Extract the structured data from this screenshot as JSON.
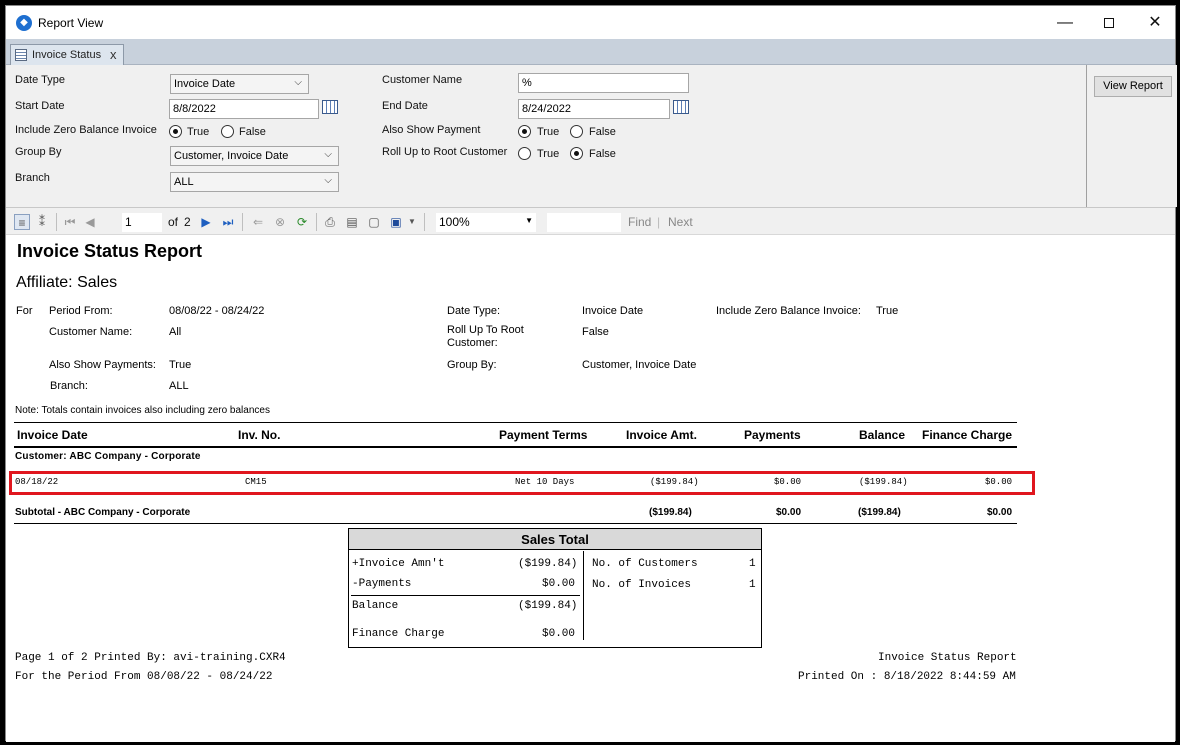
{
  "window": {
    "title": "Report View",
    "minimize": "—",
    "close": "✕"
  },
  "tab": {
    "label": "Invoice Status",
    "close": "x"
  },
  "params": {
    "date_type_label": "Date Type",
    "date_type_value": "Invoice Date",
    "start_date_label": "Start Date",
    "start_date_value": "8/8/2022",
    "include_zero_label": "Include Zero Balance Invoice",
    "true_label": "True",
    "false_label": "False",
    "group_by_label": "Group By",
    "group_by_value": "Customer, Invoice Date",
    "branch_label": "Branch",
    "branch_value": "ALL",
    "customer_name_label": "Customer Name",
    "customer_name_value": "%",
    "end_date_label": "End Date",
    "end_date_value": "8/24/2022",
    "also_show_payment_label": "Also Show Payment",
    "roll_up_label": "Roll Up to Root Customer",
    "view_report": "View Report"
  },
  "toolbar": {
    "page_current": "1",
    "page_of": "of",
    "page_total": "2",
    "zoom": "100%",
    "find": "Find",
    "separator": "|",
    "next": "Next"
  },
  "report": {
    "title": "Invoice Status Report",
    "affiliate": "Affiliate: Sales",
    "for_label": "For",
    "period_from_label": "Period From:",
    "period_from_value": "08/08/22 - 08/24/22",
    "customer_name_label": "Customer Name:",
    "customer_name_value": "All",
    "also_show_payments_label": "Also Show Payments:",
    "also_show_payments_value": "True",
    "branch_label": "Branch:",
    "branch_value": "ALL",
    "date_type_label": "Date Type:",
    "date_type_value": "Invoice Date",
    "roll_up_label_1": "Roll Up To Root",
    "roll_up_label_2": "Customer:",
    "roll_up_value": "False",
    "group_by_label": "Group By:",
    "group_by_value": "Customer, Invoice Date",
    "include_zero_label": "Include Zero Balance Invoice:",
    "include_zero_value": "True",
    "note": "Note: Totals contain invoices also including zero balances",
    "columns": {
      "invoice_date": "Invoice Date",
      "inv_no": "Inv. No.",
      "payment_terms": "Payment Terms",
      "invoice_amt": "Invoice Amt.",
      "payments": "Payments",
      "balance": "Balance",
      "finance_charge": "Finance Charge"
    },
    "customer_header": "Customer: ABC Company - Corporate",
    "row": {
      "invoice_date": "08/18/22",
      "inv_no": "CM15",
      "payment_terms": "Net 10 Days",
      "invoice_amt": "($199.84)",
      "payments": "$0.00",
      "balance": "($199.84)",
      "finance_charge": "$0.00"
    },
    "subtotal": {
      "label": "Subtotal - ABC Company - Corporate",
      "invoice_amt": "($199.84)",
      "payments": "$0.00",
      "balance": "($199.84)",
      "finance_charge": "$0.00"
    },
    "sales_total": {
      "title": "Sales Total",
      "invoice_amnt_label": "+Invoice Amn't",
      "invoice_amnt_value": "($199.84)",
      "payments_label": "-Payments",
      "payments_value": "$0.00",
      "balance_label": "Balance",
      "balance_value": "($199.84)",
      "finance_charge_label": "Finance Charge",
      "finance_charge_value": "$0.00",
      "customers_label": "No. of Customers",
      "customers_value": "1",
      "invoices_label": "No. of Invoices",
      "invoices_value": "1"
    },
    "footer": {
      "page_info": "Page 1 of 2 Printed By: avi-training.CXR4",
      "period": "For the Period From 08/08/22 - 08/24/22",
      "report_name": "Invoice Status Report",
      "printed_on": "Printed On : 8/18/2022 8:44:59 AM"
    }
  },
  "colors": {
    "highlight": "#e0161e",
    "tabstrip": "#c8d1dc",
    "panel": "#f0f0f0"
  }
}
